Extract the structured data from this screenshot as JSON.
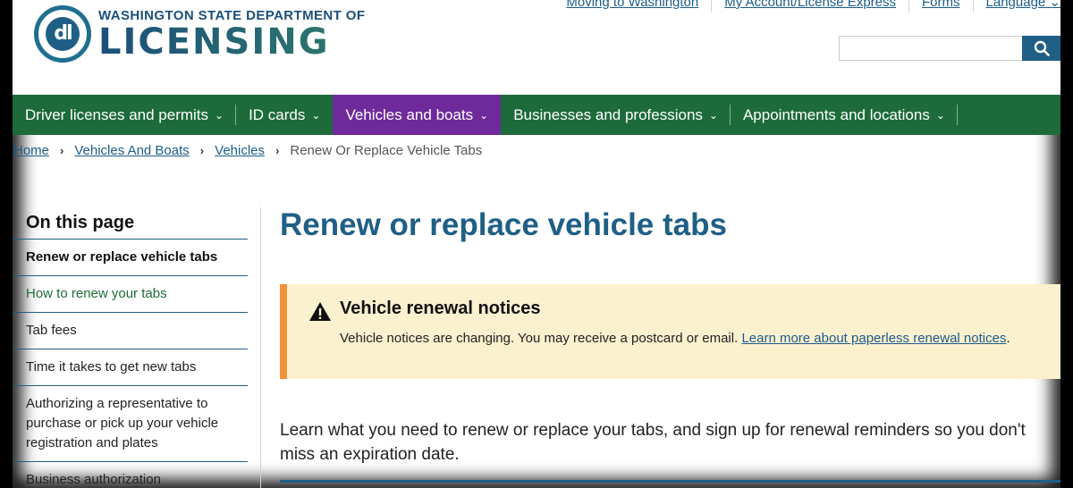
{
  "header": {
    "logo_line1": "WASHINGTON STATE DEPARTMENT OF",
    "logo_line2": "LICENSING",
    "logo_letters": "dl",
    "utility_links": [
      "Moving to Washington",
      "My Account/License Express",
      "Forms",
      "Language ⌄"
    ],
    "search_placeholder": "",
    "search_icon": "search-icon"
  },
  "nav": {
    "items": [
      {
        "label": "Driver licenses and permits"
      },
      {
        "label": "ID cards"
      },
      {
        "label": "Vehicles and boats",
        "active": true
      },
      {
        "label": "Businesses and professions"
      },
      {
        "label": "Appointments and locations"
      }
    ],
    "chevron": "⌄"
  },
  "breadcrumb": {
    "links": [
      "Home",
      "Vehicles And Boats",
      "Vehicles"
    ],
    "current": "Renew Or Replace Vehicle Tabs",
    "separator": "›"
  },
  "sidebar": {
    "title": "On this page",
    "items": [
      "Renew or replace vehicle tabs",
      "How to renew your tabs",
      "Tab fees",
      "Time it takes to get new tabs",
      "Authorizing a representative to purchase or pick up your vehicle registration and plates",
      "Business authorization"
    ]
  },
  "main": {
    "title": "Renew or replace vehicle tabs",
    "alert": {
      "title": "Vehicle renewal notices",
      "body_text": "Vehicle notices are changing. You may receive a postcard or email. ",
      "link_text": "Learn more about paperless renewal notices",
      "trail": "."
    },
    "intro": "Learn what you need to renew or replace your tabs, and sign up for renewal reminders so you don't miss an expiration date."
  },
  "colors": {
    "nav_green": "#1d6b3a",
    "nav_active_purple": "#6e2a9b",
    "brand_blue": "#1f5f86",
    "alert_bg": "#fbf1cf",
    "alert_border": "#f0923a"
  }
}
